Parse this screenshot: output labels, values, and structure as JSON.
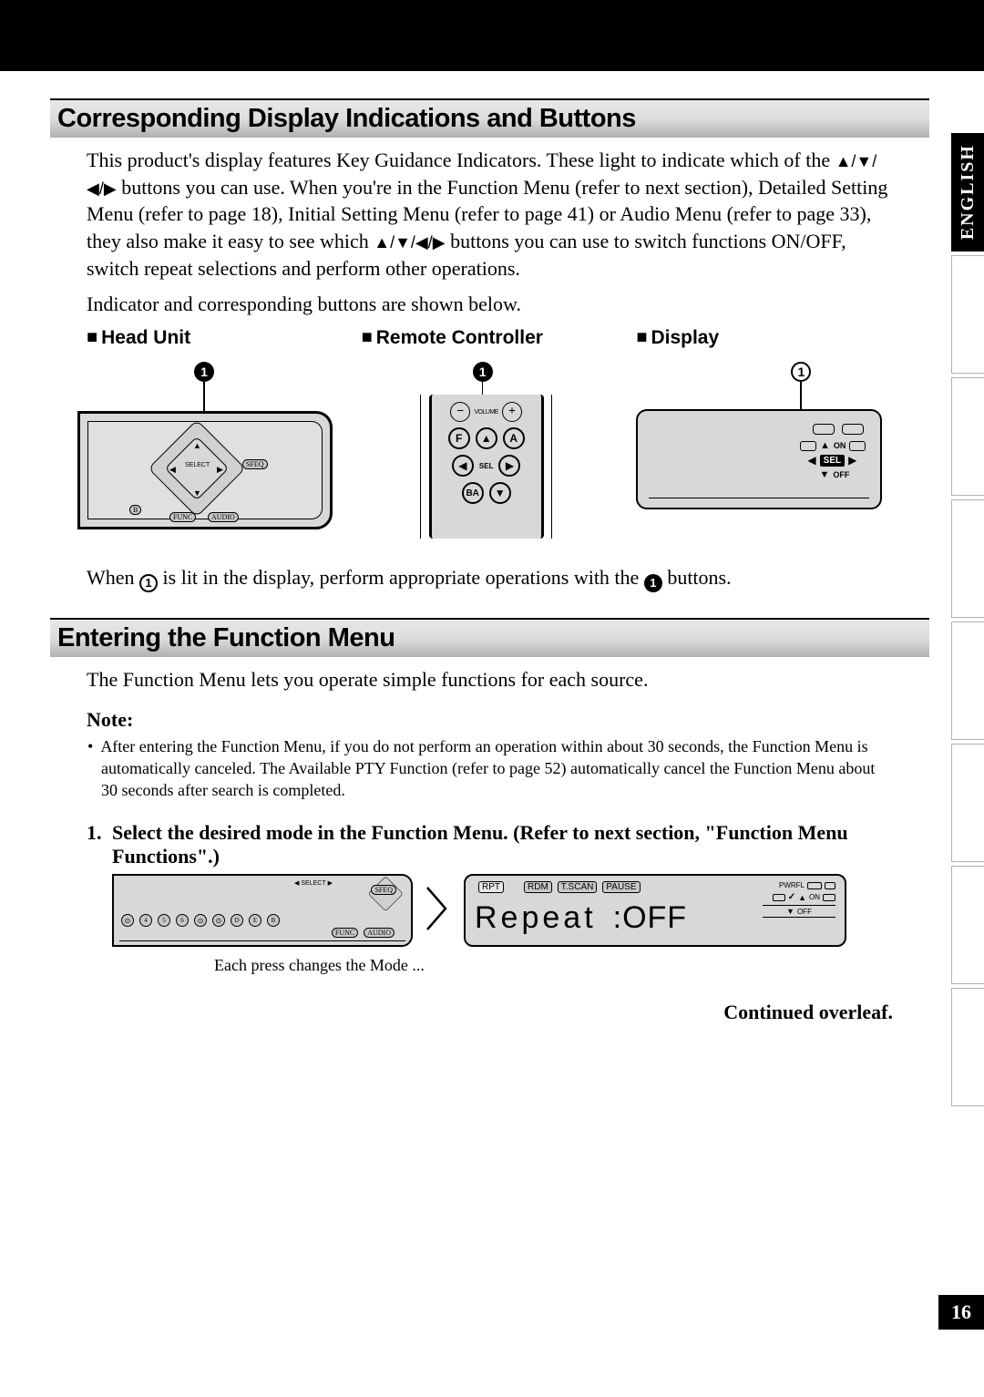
{
  "side_tab": "ENGLISH",
  "page_number": "16",
  "section1": {
    "title": "Corresponding Display Indications and Buttons",
    "para1a": "This product's display features Key Guidance Indicators. These light to indicate which of the ",
    "para1b": " buttons you can use. When you're in the Function Menu (refer to next section), Detailed Setting Menu (refer to page 18), Initial Setting Menu (refer to page 41) or Audio Menu (refer to page 33), they also make it easy to see which ",
    "para1c": " buttons you can use to switch functions ON/OFF, switch repeat selections and perform other operations.",
    "para2": "Indicator and corresponding buttons are shown below.",
    "arrows": "▲/▼/◀/▶",
    "col1": "Head Unit",
    "col2": "Remote Controller",
    "col3": "Display",
    "callout": "1",
    "labels": {
      "select": "SELECT",
      "sfeq": "SFEQ",
      "func": "FUNC",
      "audio": "AUDIO",
      "b": "B",
      "vol": "VOLUME",
      "sel": "SEL",
      "f": "F",
      "a": "A",
      "ba": "BA",
      "on": "ON",
      "off": "OFF",
      "sel2": "SEL"
    },
    "footer_a": "When ",
    "footer_b": " is lit in the display, perform appropriate operations with the ",
    "footer_c": " buttons."
  },
  "section2": {
    "title": "Entering the Function Menu",
    "intro": "The Function Menu lets you operate simple functions for each source.",
    "note_label": "Note:",
    "note_body": "After entering the Function Menu, if you do not perform an operation within about 30 seconds, the Function Menu is automatically canceled. The Available PTY Function (refer to page 52) automatically cancel the Function Menu about 30 seconds after search is completed.",
    "step_num": "1.",
    "step_text": "Select the desired mode in the Function Menu. (Refer to next section, \"Function Menu Functions\".)",
    "lcd": {
      "rpt": "RPT",
      "rdm": "RDM",
      "tscan": "T.SCAN",
      "pause": "PAUSE",
      "main": "Repeat",
      "value": ":OFF",
      "pwrfl": "PWRFL",
      "on": "ON",
      "off": "OFF"
    },
    "caption": "Each press changes the Mode ...",
    "continued": "Continued overleaf."
  }
}
